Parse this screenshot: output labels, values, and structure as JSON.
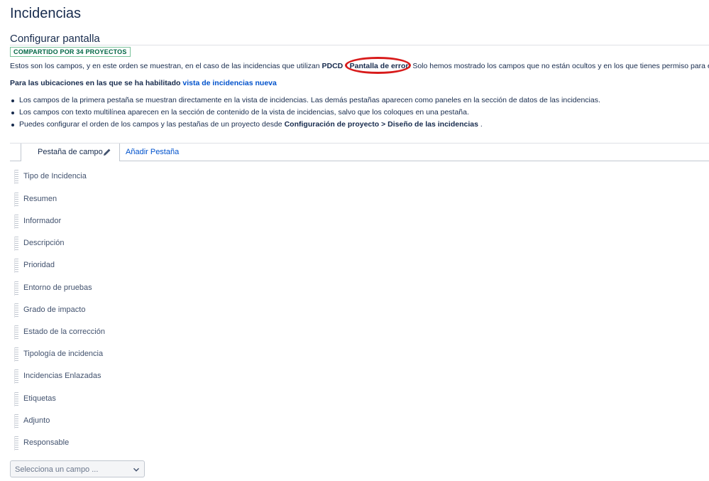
{
  "page": {
    "title": "Incidencias",
    "section_title": "Configurar pantalla",
    "shared_badge": "COMPARTIDO POR 34 PROYECTOS"
  },
  "intro": {
    "before": "Estos son los campos, y en este orden se muestran, en el caso de las incidencias que utilizan",
    "project": "PDCD",
    "dash": " - ",
    "screen": "Pantalla de error",
    "after": ". Solo hemos mostrado los campos que no están ocultos y en los que tienes permiso para editar."
  },
  "new_view": {
    "text": "Para las ubicaciones en las que se ha habilitado",
    "link": "vista de incidencias nueva"
  },
  "bullets": {
    "b1": "Los campos de la primera pestaña se muestran directamente en la vista de incidencias. Las demás pestañas aparecen como paneles en la sección de datos de las incidencias.",
    "b2": "Los campos con texto multilínea aparecen en la sección de contenido de la vista de incidencias, salvo que los coloques en una pestaña.",
    "b3_before": "Puedes configurar el orden de los campos y las pestañas de un proyecto desde",
    "b3_bold": "Configuración de proyecto > Diseño de las incidencias",
    "b3_after": "."
  },
  "tabs": {
    "active": "Pestaña de campo",
    "add": "Añadir Pestaña"
  },
  "fields": [
    "Tipo de Incidencia",
    "Resumen",
    "Informador",
    "Descripción",
    "Prioridad",
    "Entorno de pruebas",
    "Grado de impacto",
    "Estado de la corrección",
    "Tipología de incidencia",
    "Incidencias Enlazadas",
    "Etiquetas",
    "Adjunto",
    "Responsable"
  ],
  "select": {
    "placeholder": "Selecciona un campo ..."
  },
  "colors": {
    "link": "#0052cc",
    "text": "#172b4d",
    "badge": "#006644",
    "annotation_oval": "#d81b1b"
  }
}
